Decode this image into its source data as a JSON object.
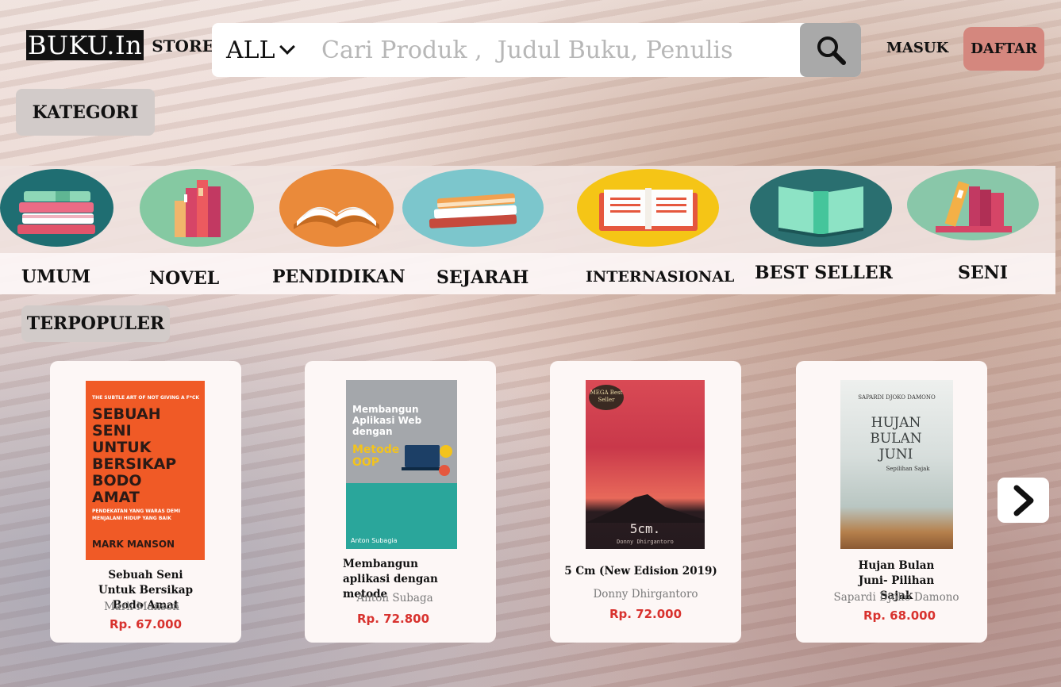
{
  "header": {
    "logo_text": "BUKU.In",
    "logo_sub": "STORE",
    "search_category": "ALL",
    "search_placeholder": "Cari Produk ,  Judul Buku, Penulis",
    "login_label": "MASUK",
    "register_label": "DAFTAR"
  },
  "kategori_label": "KATEGORI",
  "categories": [
    {
      "label": "UMUM",
      "icon": "stacked-books-icon"
    },
    {
      "label": "NOVEL",
      "icon": "standing-books-icon"
    },
    {
      "label": "PENDIDIKAN",
      "icon": "open-book-icon"
    },
    {
      "label": "SEJARAH",
      "icon": "book-pile-icon"
    },
    {
      "label": "INTERNASIONAL",
      "icon": "open-book-icon"
    },
    {
      "label": "BEST SELLER",
      "icon": "open-book-front-icon"
    },
    {
      "label": "SENI",
      "icon": "leaning-books-icon"
    }
  ],
  "popular_label": "TERPOPULER",
  "products": [
    {
      "title": "Sebuah Seni Untuk Bersikap Bodo Amat",
      "author": "Mark Manson",
      "price": "Rp. 67.000",
      "cover": {
        "top": "THE SUBTLE ART OF NOT GIVING A F*CK",
        "title": "SEBUAH SENI UNTUK BERSIKAP BODO AMAT",
        "subtitle": "PENDEKATAN YANG WARAS DEMI MENJALANI HIDUP YANG BAIK",
        "author": "MARK MANSON",
        "color": "#f05a26"
      }
    },
    {
      "title": "Membangun aplikasi dengan metode",
      "author": "Anton Subaga",
      "price": "Rp. 72.800",
      "cover": {
        "title": "Membangun Aplikasi Web dengan",
        "title2": "Metode OOP",
        "author": "Anton Subagia",
        "color": "#2aa69b"
      }
    },
    {
      "title": "5 Cm (New Edision 2019)",
      "author": "Donny Dhirgantoro",
      "price": "Rp. 72.000",
      "cover": {
        "badge": "MEGA Best Seller",
        "title": "5cm.",
        "author": "Donny Dhirgantoro",
        "color": "#c43a3c"
      }
    },
    {
      "title": "Hujan Bulan Juni- Pilihan Sajak",
      "author": "Sapardi Djoko  Damono",
      "price": "Rp. 68.000",
      "cover": {
        "top": "SAPARDI DJOKO DAMONO",
        "title": "HUJAN BULAN JUNI",
        "subtitle": "Sepilihan Sajak",
        "color": "#c9d2d0"
      }
    }
  ],
  "colors": {
    "price": "#d8322e",
    "register_bg": "#d4877e",
    "search_btn": "#a9a9a9"
  }
}
